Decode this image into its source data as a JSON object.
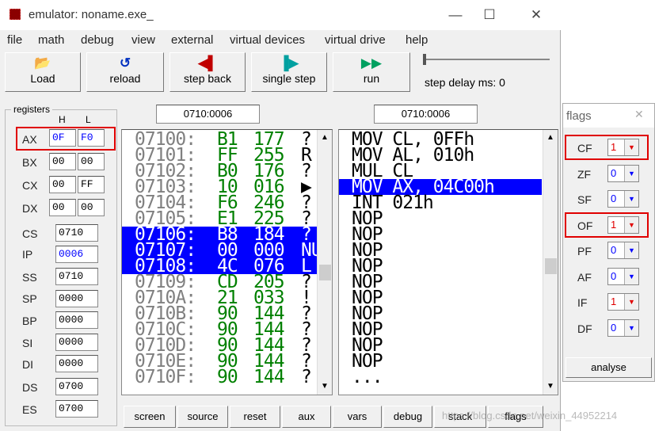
{
  "window": {
    "title": "emulator: noname.exe_",
    "minimize": "—",
    "maximize": "☐",
    "close": "✕"
  },
  "menu": [
    "file",
    "math",
    "debug",
    "view",
    "external",
    "virtual devices",
    "virtual drive",
    "help"
  ],
  "toolbar": {
    "load": "Load",
    "reload": "reload",
    "step_back": "step back",
    "single_step": "single step",
    "run": "run",
    "step_delay": "step delay ms: 0"
  },
  "registers": {
    "group_label": "registers",
    "col_h": "H",
    "col_l": "L",
    "byte_regs": [
      {
        "name": "AX",
        "h": "0F",
        "l": "F0"
      },
      {
        "name": "BX",
        "h": "00",
        "l": "00"
      },
      {
        "name": "CX",
        "h": "00",
        "l": "FF"
      },
      {
        "name": "DX",
        "h": "00",
        "l": "00"
      }
    ],
    "word_regs": [
      {
        "name": "CS",
        "value": "0710"
      },
      {
        "name": "IP",
        "value": "0006"
      },
      {
        "name": "SS",
        "value": "0710"
      },
      {
        "name": "SP",
        "value": "0000"
      },
      {
        "name": "BP",
        "value": "0000"
      },
      {
        "name": "SI",
        "value": "0000"
      },
      {
        "name": "DI",
        "value": "0000"
      },
      {
        "name": "DS",
        "value": "0700"
      },
      {
        "name": "ES",
        "value": "0700"
      }
    ]
  },
  "memory": {
    "address": "0710:0006",
    "rows": [
      {
        "addr": "07100:",
        "hex": "B1",
        "dec": "177",
        "ch": "?"
      },
      {
        "addr": "07101:",
        "hex": "FF",
        "dec": "255",
        "ch": "R"
      },
      {
        "addr": "07102:",
        "hex": "B0",
        "dec": "176",
        "ch": "?"
      },
      {
        "addr": "07103:",
        "hex": "10",
        "dec": "016",
        "ch": "▶"
      },
      {
        "addr": "07104:",
        "hex": "F6",
        "dec": "246",
        "ch": "?"
      },
      {
        "addr": "07105:",
        "hex": "E1",
        "dec": "225",
        "ch": "?"
      },
      {
        "addr": "07106:",
        "hex": "B8",
        "dec": "184",
        "ch": "?"
      },
      {
        "addr": "07107:",
        "hex": "00",
        "dec": "000",
        "ch": "NU"
      },
      {
        "addr": "07108:",
        "hex": "4C",
        "dec": "076",
        "ch": "L"
      },
      {
        "addr": "07109:",
        "hex": "CD",
        "dec": "205",
        "ch": "?"
      },
      {
        "addr": "0710A:",
        "hex": "21",
        "dec": "033",
        "ch": "!"
      },
      {
        "addr": "0710B:",
        "hex": "90",
        "dec": "144",
        "ch": "?"
      },
      {
        "addr": "0710C:",
        "hex": "90",
        "dec": "144",
        "ch": "?"
      },
      {
        "addr": "0710D:",
        "hex": "90",
        "dec": "144",
        "ch": "?"
      },
      {
        "addr": "0710E:",
        "hex": "90",
        "dec": "144",
        "ch": "?"
      },
      {
        "addr": "0710F:",
        "hex": "90",
        "dec": "144",
        "ch": "?"
      }
    ]
  },
  "disasm": {
    "address": "0710:0006",
    "lines": [
      "MOV CL, 0FFh",
      "MOV AL, 010h",
      "MUL CL",
      "MOV AX, 04C00h",
      "INT 021h",
      "NOP",
      "NOP",
      "NOP",
      "NOP",
      "NOP",
      "NOP",
      "NOP",
      "NOP",
      "NOP",
      "NOP",
      "..."
    ]
  },
  "bottom_buttons": [
    "screen",
    "source",
    "reset",
    "aux",
    "vars",
    "debug",
    "stack",
    "flags"
  ],
  "flags": {
    "title": "flags",
    "items": [
      {
        "name": "CF",
        "value": "1"
      },
      {
        "name": "ZF",
        "value": "0"
      },
      {
        "name": "SF",
        "value": "0"
      },
      {
        "name": "OF",
        "value": "1"
      },
      {
        "name": "PF",
        "value": "0"
      },
      {
        "name": "AF",
        "value": "0"
      },
      {
        "name": "IF",
        "value": "1"
      },
      {
        "name": "DF",
        "value": "0"
      }
    ],
    "analyse": "analyse"
  },
  "watermark": "https://blog.csdn.net/weixin_44952214",
  "colors": {
    "highlight": "#0000ff",
    "addr_gray": "#808080",
    "hex_green": "#008000",
    "blue_value": "#0000ff",
    "red_value": "#e00000",
    "red_box": "#e00000"
  }
}
